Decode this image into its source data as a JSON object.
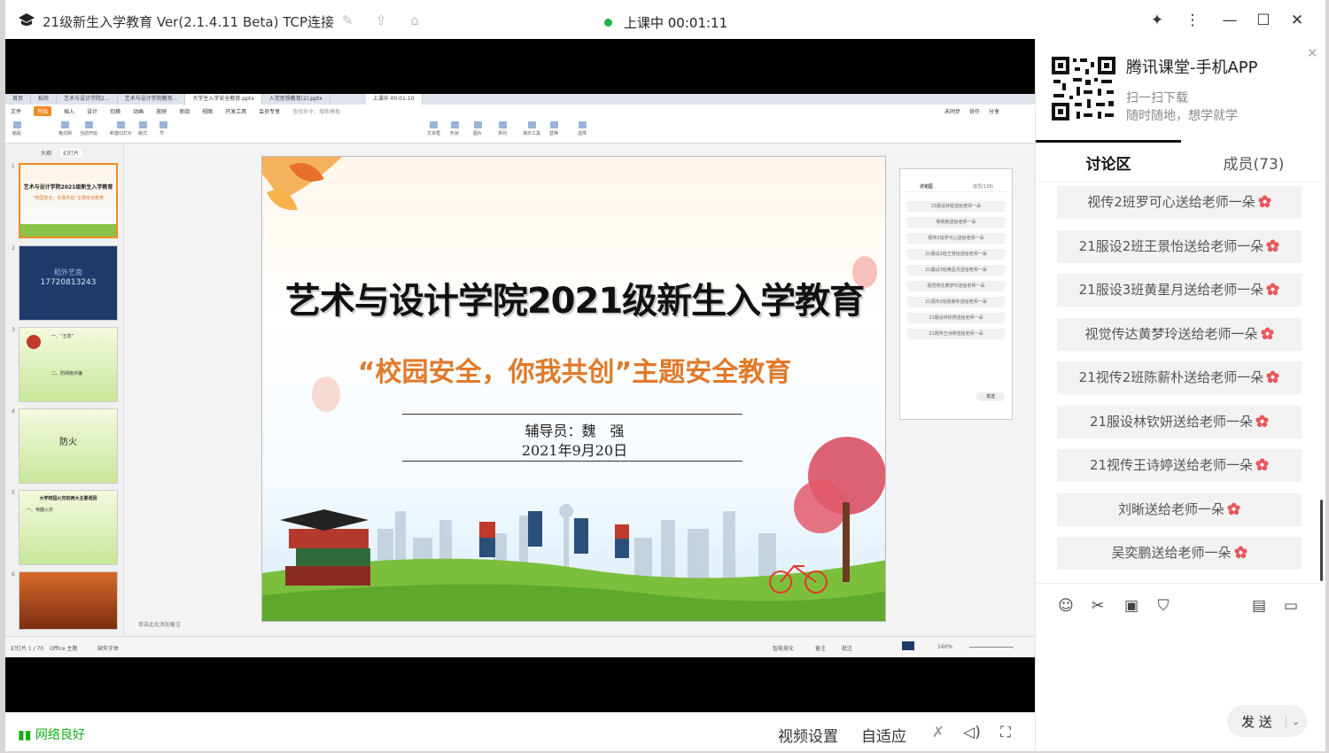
{
  "window": {
    "title": "21级新生入学教育 Ver(2.1.4.11 Beta)  TCP连接",
    "status_label": "上课中 00:01:11"
  },
  "shared_screen": {
    "wps_tabs": [
      "首页",
      "稻壳",
      "艺术与设计学院2...",
      "艺术与设计学院教务...",
      "大学生入学安全教育.pptx",
      "入党思想教育(2).pptx",
      "上课中 00:01:10"
    ],
    "wps_menu": [
      "文件",
      "开始",
      "插入",
      "设计",
      "切换",
      "动画",
      "放映",
      "审阅",
      "视图",
      "开发工具",
      "会员专享",
      "查找命令、搜索模板"
    ],
    "wps_menu_right": [
      "未同步",
      "协作",
      "分享"
    ],
    "ribbon_labels": [
      "粘贴",
      "格式刷",
      "当前开始",
      "新建幻灯片",
      "版式",
      "节",
      "文本框",
      "形状",
      "图片",
      "排列",
      "演示工具",
      "替换",
      "选择"
    ],
    "thumb_tabs": [
      "大纲",
      "幻灯片"
    ],
    "thumbs": [
      {
        "num": "1",
        "title": "艺术与设计学院2021级新生入学教育",
        "sub": "“校园安全，你我共创”主题安全教育"
      },
      {
        "num": "2",
        "title": "稻外艺南",
        "sub": "17720813243"
      },
      {
        "num": "3",
        "title": "一、“五防”",
        "sub": "二、防网络诈骗"
      },
      {
        "num": "4",
        "title": "防火",
        "sub": ""
      },
      {
        "num": "5",
        "title": "大学校园火灾的两大主要诱因",
        "sub": "一、电器火灾"
      },
      {
        "num": "6",
        "title": "",
        "sub": ""
      }
    ],
    "slide": {
      "title": "艺术与设计学院2021级新生入学教育",
      "subtitle": "“校园安全，你我共创”主题安全教育",
      "advisor": "辅导员：魏　强",
      "date": "2021年9月20日"
    },
    "mini_panel": {
      "tab_discuss": "讨论区",
      "tab_members": "成员(138)",
      "rows": [
        "21服设林锐送给老师一朵",
        "吴奕鹏送给老师一朵",
        "视传2班罗可心送给老师一朵",
        "21服设2班王景怡送给老师一朵",
        "21服设3班黄星月送给老师一朵",
        "视觉传达黄梦玲送给老师一朵",
        "21视传2班陈薪朴送给老师一朵",
        "21服设林钦妍送给老师一朵",
        "21视传王诗婷送给老师一朵"
      ],
      "send": "发送"
    },
    "notes_placeholder": "单击此处添加备注",
    "status_left": [
      "幻灯片 1 / 70",
      "Office 主题",
      "缺失字体"
    ],
    "status_right": [
      "智能美化",
      "备注",
      "批注",
      "160%"
    ]
  },
  "bottom_bar": {
    "network": "网络良好",
    "video_settings": "视频设置",
    "auto_fit": "自适应"
  },
  "panel": {
    "app_title": "腾讯课堂-手机APP",
    "app_sub1": "扫一扫下载",
    "app_sub2": "随时随地，想学就学",
    "tab_discuss": "讨论区",
    "tab_members": "成员(73)",
    "messages": [
      "视传2班罗可心送给老师一朵",
      "21服设2班王景怡送给老师一朵",
      "21服设3班黄星月送给老师一朵",
      "视觉传达黄梦玲送给老师一朵",
      "21视传2班陈薪朴送给老师一朵",
      "21服设林钦妍送给老师一朵",
      "21视传王诗婷送给老师一朵",
      "刘晰送给老师一朵",
      "吴奕鹏送给老师一朵"
    ],
    "send_label": "发 送"
  },
  "colors": {
    "accent_green": "#22b14c",
    "flower": "#e8575a",
    "wps_orange": "#f08a24"
  }
}
